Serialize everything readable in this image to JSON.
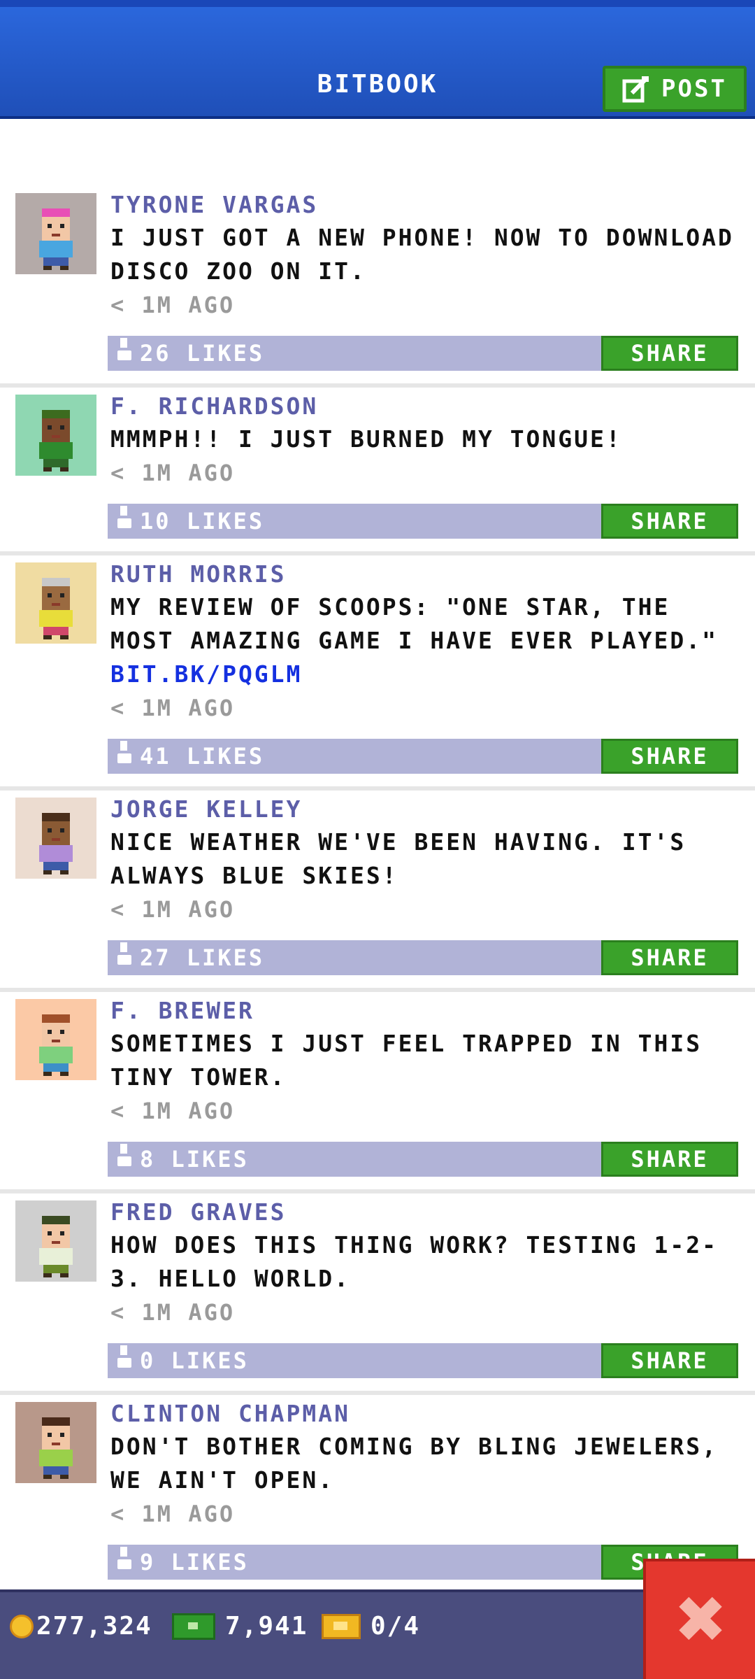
{
  "header": {
    "title": "BITBOOK",
    "post_label": "POST"
  },
  "posts": [
    {
      "author": "TYRONE VARGAS",
      "message": "I JUST GOT A NEW PHONE! NOW TO DOWNLOAD DISCO ZOO ON IT.",
      "link": "",
      "time": "< 1M AGO",
      "likes": "26 LIKES",
      "share": "SHARE",
      "avatar_bg": "#b4aaa8",
      "skin": "#f2c7a6",
      "hair": "#e84fb6",
      "shirt": "#49a6e0",
      "pants": "#3d5ba8"
    },
    {
      "author": "F. RICHARDSON",
      "message": "MMMPH!! I JUST BURNED MY TONGUE!",
      "link": "",
      "time": "< 1M AGO",
      "likes": "10 LIKES",
      "share": "SHARE",
      "avatar_bg": "#8fd7b2",
      "skin": "#7b4a2c",
      "hair": "#3c6b1f",
      "shirt": "#2e8b2e",
      "pants": "#2e6a2a"
    },
    {
      "author": "RUTH MORRIS",
      "message": "MY REVIEW OF SCOOPS: \"ONE STAR, THE MOST AMAZING GAME I HAVE EVER PLAYED.\"",
      "link": "BIT.BK/PQGLM",
      "time": "< 1M AGO",
      "likes": "41 LIKES",
      "share": "SHARE",
      "avatar_bg": "#f0dca2",
      "skin": "#9a6a40",
      "hair": "#c8c8c8",
      "shirt": "#e8dd3a",
      "pants": "#d0486a"
    },
    {
      "author": "JORGE KELLEY",
      "message": "NICE WEATHER WE'VE BEEN HAVING. IT'S ALWAYS BLUE SKIES!",
      "link": "",
      "time": "< 1M AGO",
      "likes": "27 LIKES",
      "share": "SHARE",
      "avatar_bg": "#ecdcd0",
      "skin": "#8a5a34",
      "hair": "#4a2e1a",
      "shirt": "#b08cd8",
      "pants": "#3d5ba8"
    },
    {
      "author": "F. BREWER",
      "message": "SOMETIMES I JUST FEEL TRAPPED IN THIS TINY TOWER.",
      "link": "",
      "time": "< 1M AGO",
      "likes": "8 LIKES",
      "share": "SHARE",
      "avatar_bg": "#fbc9a6",
      "skin": "#f2c7a6",
      "hair": "#a0502a",
      "shirt": "#7ed07e",
      "pants": "#3d8fc8"
    },
    {
      "author": "FRED GRAVES",
      "message": "HOW DOES THIS THING WORK? TESTING 1-2-3. HELLO WORLD.",
      "link": "",
      "time": "< 1M AGO",
      "likes": "0 LIKES",
      "share": "SHARE",
      "avatar_bg": "#cfcfcf",
      "skin": "#f2c7a6",
      "hair": "#3a4a22",
      "shirt": "#e8f0d8",
      "pants": "#6a8a2a"
    },
    {
      "author": "CLINTON CHAPMAN",
      "message": "DON'T BOTHER COMING BY BLING JEWELERS, WE AIN'T OPEN.",
      "link": "",
      "time": "< 1M AGO",
      "likes": "9 LIKES",
      "share": "SHARE",
      "avatar_bg": "#b8988a",
      "skin": "#f2c7a6",
      "hair": "#4a2a1a",
      "shirt": "#9ad04a",
      "pants": "#3d5ba8"
    }
  ],
  "status_bar": {
    "coins": "277,324",
    "bux": "7,941",
    "tickets": "0/4"
  },
  "icons": {
    "post": "edit-icon",
    "close": "close-icon",
    "coin": "coin-icon",
    "bux": "bux-icon",
    "ticket": "ticket-icon"
  },
  "colors": {
    "header": "#2b67dc",
    "accent_green": "#3aa22a",
    "likes_bar": "#b1b3d7",
    "author": "#5c5ea8",
    "link": "#1430e0",
    "close": "#e4372e"
  }
}
